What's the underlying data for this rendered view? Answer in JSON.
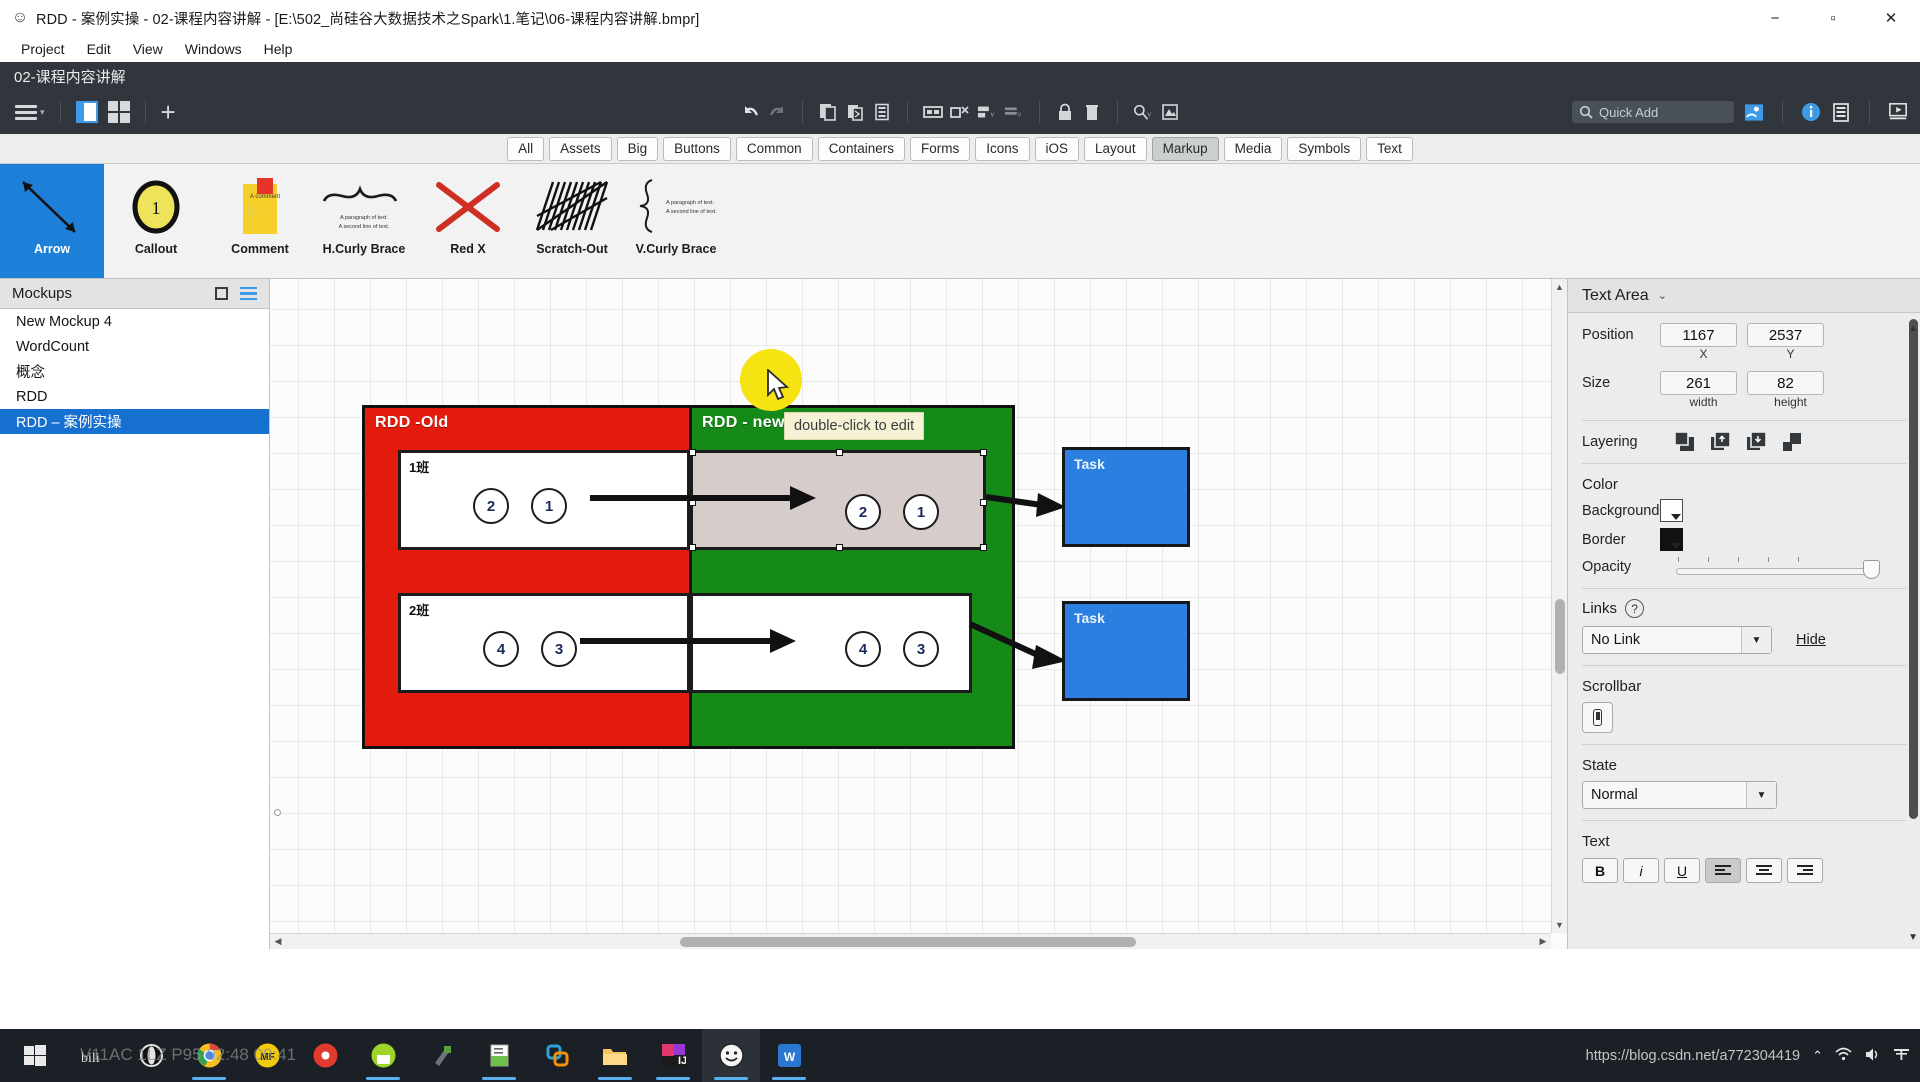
{
  "window": {
    "app_icon": "smiley-icon",
    "title": "RDD - 案例实操 - 02-课程内容讲解 - [E:\\502_尚硅谷大数据技术之Spark\\1.笔记\\06-课程内容讲解.bmpr]",
    "minimize": "−",
    "maximize": "▫",
    "close": "✕"
  },
  "menubar": {
    "items": [
      "Project",
      "Edit",
      "View",
      "Windows",
      "Help"
    ]
  },
  "apphdr": {
    "project_title": "02-课程内容讲解",
    "quick_add_placeholder": "Quick Add",
    "icons_left": [
      "hamburger-menu-icon",
      "panel-toggle-icon",
      "grid-view-icon",
      "add-mockup-icon"
    ],
    "icons_center": [
      "undo-icon",
      "redo-icon",
      "copy-icon",
      "paste-icon",
      "duplicate-icon",
      "group-icon",
      "ungroup-icon",
      "align-icon",
      "distribute-icon",
      "lock-icon",
      "delete-icon",
      "zoom-icon",
      "export-icon"
    ],
    "icons_right": [
      "account-icon",
      "info-icon",
      "notes-icon",
      "present-icon"
    ]
  },
  "categories": {
    "items": [
      "All",
      "Assets",
      "Big",
      "Buttons",
      "Common",
      "Containers",
      "Forms",
      "Icons",
      "iOS",
      "Layout",
      "Markup",
      "Media",
      "Symbols",
      "Text"
    ],
    "active": "Markup"
  },
  "palette": {
    "items": [
      {
        "label": "Arrow",
        "icon": "arrow-widget-icon",
        "selected": true
      },
      {
        "label": "Callout",
        "icon": "callout-widget-icon",
        "selected": false
      },
      {
        "label": "Comment",
        "icon": "comment-widget-icon",
        "selected": false
      },
      {
        "label": "H.Curly Brace",
        "icon": "h-curly-brace-widget-icon",
        "selected": false
      },
      {
        "label": "Red X",
        "icon": "red-x-widget-icon",
        "selected": false
      },
      {
        "label": "Scratch-Out",
        "icon": "scratch-out-widget-icon",
        "selected": false
      },
      {
        "label": "V.Curly Brace",
        "icon": "v-curly-brace-widget-icon",
        "selected": false
      }
    ],
    "comment_text": "A comment",
    "brace_text_line1": "A paragraph of text.",
    "brace_text_line2": "A second line of text.",
    "callout_number": "1"
  },
  "sidebar": {
    "header": "Mockups",
    "items": [
      {
        "label": "New Mockup 4",
        "selected": false
      },
      {
        "label": "WordCount",
        "selected": false
      },
      {
        "label": "概念",
        "selected": false
      },
      {
        "label": "RDD",
        "selected": false
      },
      {
        "label": "RDD – 案例实操",
        "selected": true
      }
    ]
  },
  "canvas": {
    "tooltip": "double-click to edit",
    "red_panel_label": "RDD -Old",
    "green_panel_label": "RDD - new",
    "row1": {
      "label": "1班",
      "left_circles": [
        "2",
        "1"
      ],
      "right_circles": [
        "2",
        "1"
      ]
    },
    "row2": {
      "label": "2班",
      "left_circles": [
        "4",
        "3"
      ],
      "right_circles": [
        "4",
        "3"
      ]
    },
    "task_boxes": [
      "Task",
      "Task"
    ]
  },
  "properties": {
    "header": "Text Area",
    "position_label": "Position",
    "position_x": "1167",
    "position_y": "2537",
    "x_sub": "X",
    "y_sub": "Y",
    "size_label": "Size",
    "size_width": "261",
    "size_height": "82",
    "width_sub": "width",
    "height_sub": "height",
    "layering_label": "Layering",
    "layering_icons": [
      "bring-to-front-icon",
      "bring-forward-icon",
      "send-backward-icon",
      "send-to-back-icon"
    ],
    "color_label": "Color",
    "background_label": "Background",
    "background_color": "#ffffff",
    "border_label": "Border",
    "border_color": "#111111",
    "opacity_label": "Opacity",
    "links_label": "Links",
    "links_help": "?",
    "link_value": "No Link",
    "hide_label": "Hide",
    "scrollbar_label": "Scrollbar",
    "state_label": "State",
    "state_value": "Normal",
    "text_label": "Text",
    "text_buttons": [
      "B",
      "i",
      "U",
      "align-left",
      "align-center",
      "align-right"
    ]
  },
  "taskbar": {
    "ghost_text": "V11AC  1LZ  P95  02:48  09:41",
    "watermark": "https://blog.csdn.net/a772304419",
    "items": [
      {
        "icon": "windows-start-icon",
        "active": false,
        "running": false
      },
      {
        "icon": "bilibili-icon",
        "active": false,
        "running": false
      },
      {
        "icon": "opera-icon",
        "active": false,
        "running": false
      },
      {
        "icon": "chrome-icon",
        "active": false,
        "running": true
      },
      {
        "icon": "mf-icon",
        "active": false,
        "running": false
      },
      {
        "icon": "pdf-icon",
        "active": false,
        "running": false
      },
      {
        "icon": "android-icon",
        "active": false,
        "running": false
      },
      {
        "icon": "tools-icon",
        "active": false,
        "running": true
      },
      {
        "icon": "notepad-icon",
        "active": false,
        "running": true
      },
      {
        "icon": "vmware-icon",
        "active": false,
        "running": false
      },
      {
        "icon": "explorer-icon",
        "active": false,
        "running": true
      },
      {
        "icon": "intellij-icon",
        "active": false,
        "running": true
      },
      {
        "icon": "balsamiq-icon",
        "active": true,
        "running": true
      },
      {
        "icon": "wps-icon",
        "active": false,
        "running": true
      }
    ],
    "tray_icons": [
      "chevron-up-icon",
      "wifi-icon",
      "volume-icon",
      "ime-icon"
    ]
  }
}
